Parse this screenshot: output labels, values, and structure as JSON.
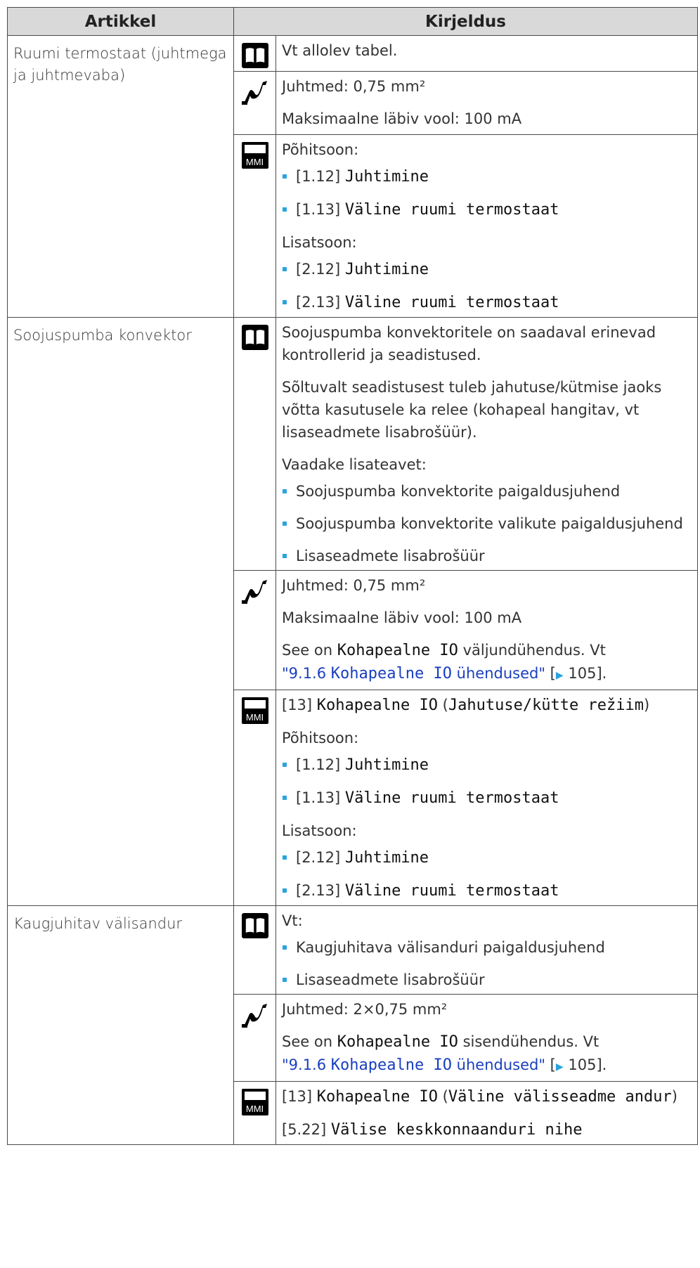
{
  "header": {
    "col1": "Artikkel",
    "col2": "Kirjeldus"
  },
  "rows": [
    {
      "item": "Ruumi termostaat (juhtmega ja juhtmevaba)",
      "book": {
        "text": "Vt allolev tabel."
      },
      "wire": {
        "line1": "Juhtmed: 0,75 mm²",
        "line2": "Maksimaalne läbiv vool: 100 mA"
      },
      "mmi": {
        "main_zone": "Põhitsoon:",
        "b1_code": "[1.12]",
        "b1_label": "Juhtimine",
        "b2_code": "[1.13]",
        "b2_label": "Väline ruumi termostaat",
        "add_zone": "Lisatsoon:",
        "b3_code": "[2.12]",
        "b3_label": "Juhtimine",
        "b4_code": "[2.13]",
        "b4_label": "Väline ruumi termostaat"
      }
    },
    {
      "item": "Soojuspumba konvektor",
      "book": {
        "p1": "Soojuspumba konvektoritele on saadaval erinevad kontrollerid ja seadistused.",
        "p2": "Sõltuvalt seadistusest tuleb jahutuse/kütmise jaoks võtta kasutusele ka relee (kohapeal hangitav, vt lisaseadmete lisabrošüür).",
        "p3": "Vaadake lisateavet:",
        "b1": "Soojuspumba konvektorite paigaldusjuhend",
        "b2": "Soojuspumba konvektorite valikute paigaldusjuhend",
        "b3": "Lisaseadmete lisabrošüür"
      },
      "wire": {
        "line1": "Juhtmed: 0,75 mm²",
        "line2": "Maksimaalne läbiv vool: 100 mA",
        "see_pre": "See on",
        "see_mono": "Kohapealne IO",
        "see_post": "väljundühendus. Vt",
        "link_num": "\"9.1.6",
        "link_mono": "Kohapealne IO",
        "link_post": "ühendused\"",
        "page": "105"
      },
      "mmi": {
        "head_code": "[13]",
        "head_mono": "Kohapealne IO",
        "head_paren": "Jahutuse/kütte režiim",
        "main_zone": "Põhitsoon:",
        "b1_code": "[1.12]",
        "b1_label": "Juhtimine",
        "b2_code": "[1.13]",
        "b2_label": "Väline ruumi termostaat",
        "add_zone": "Lisatsoon:",
        "b3_code": "[2.12]",
        "b3_label": "Juhtimine",
        "b4_code": "[2.13]",
        "b4_label": "Väline ruumi termostaat"
      }
    },
    {
      "item": "Kaugjuhitav välisandur",
      "book": {
        "p1": "Vt:",
        "b1": "Kaugjuhitava välisanduri paigaldusjuhend",
        "b2": "Lisaseadmete lisabrošüür"
      },
      "wire": {
        "line1": "Juhtmed: 2×0,75 mm²",
        "see_pre": "See on",
        "see_mono": "Kohapealne IO",
        "see_post": "sisendühendus. Vt",
        "link_num": "\"9.1.6",
        "link_mono": "Kohapealne IO",
        "link_post": "ühendused\"",
        "page": "105"
      },
      "mmi": {
        "head_code": "[13]",
        "head_mono": "Kohapealne IO",
        "head_paren": "Väline välisseadme andur",
        "line2_code": "[5.22]",
        "line2_mono": "Välise keskkonnaanduri nihe"
      }
    }
  ],
  "icons": {
    "book": "manual-book-icon",
    "wire": "wiring-icon",
    "mmi": "mmi-controller-icon",
    "mmi_text": "MMI"
  },
  "colors": {
    "header_bg": "#d9d9d9",
    "bullet": "#2aa3df",
    "link": "#1a3fbf",
    "border": "#4a4a4a"
  }
}
